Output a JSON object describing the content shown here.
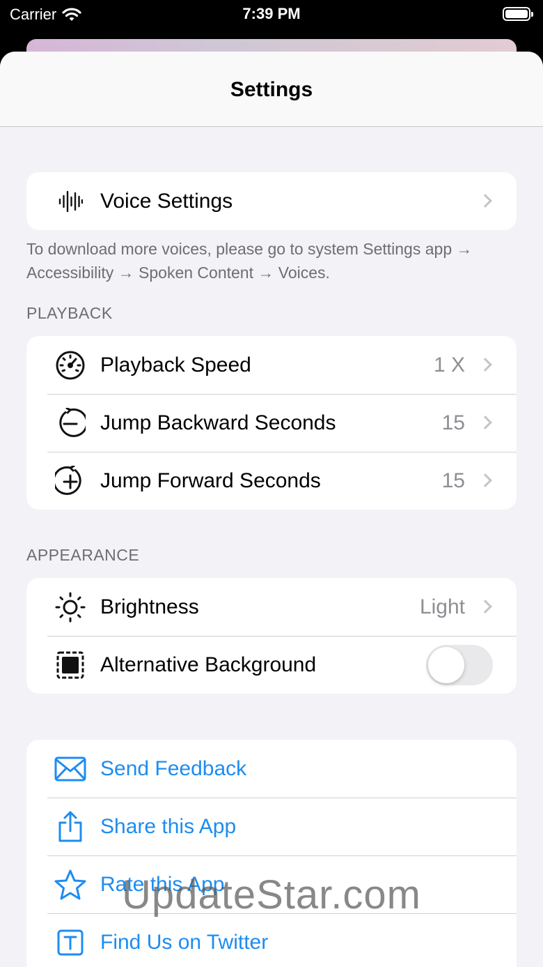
{
  "status_bar": {
    "carrier": "Carrier",
    "time": "7:39 PM"
  },
  "nav": {
    "title": "Settings"
  },
  "voice": {
    "label": "Voice Settings",
    "icon": "waveform-icon",
    "note": "To download more voices, please go to system Settings app → Accessibility → Spoken Content → Voices."
  },
  "playback": {
    "header": "PLAYBACK",
    "items": [
      {
        "label": "Playback Speed",
        "value": "1 X",
        "icon": "speedometer-icon"
      },
      {
        "label": "Jump Backward Seconds",
        "value": "15",
        "icon": "rewind-circle-icon"
      },
      {
        "label": "Jump Forward Seconds",
        "value": "15",
        "icon": "forward-circle-icon"
      }
    ]
  },
  "appearance": {
    "header": "APPEARANCE",
    "items": [
      {
        "label": "Brightness",
        "value": "Light",
        "icon": "sun-icon"
      },
      {
        "label": "Alternative Background",
        "toggle_on": false,
        "icon": "square-dashed-icon"
      }
    ]
  },
  "links": {
    "items": [
      {
        "label": "Send Feedback",
        "icon": "envelope-icon"
      },
      {
        "label": "Share this App",
        "icon": "share-icon"
      },
      {
        "label": "Rate this App",
        "icon": "star-icon"
      },
      {
        "label": "Find Us on Twitter",
        "icon": "t-square-icon"
      }
    ]
  },
  "watermark": "UpdateStar.com",
  "colors": {
    "accent": "#1d8cf0",
    "background": "#f2f2f7",
    "secondary_text": "#8e8e93"
  }
}
